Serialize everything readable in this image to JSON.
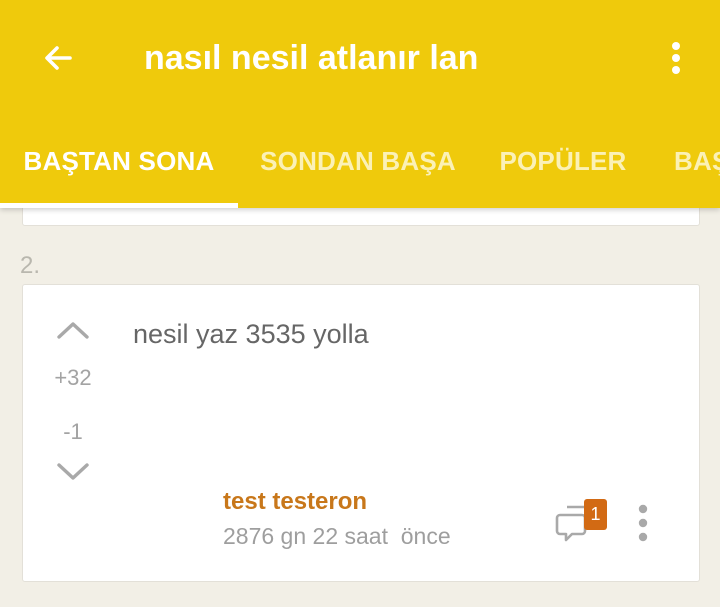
{
  "app_bar": {
    "title": "nasıl nesil atlanır lan",
    "back_icon": "arrow-left-icon",
    "menu_icon": "more-vertical-icon",
    "background_color": "#efca0c"
  },
  "tabs": [
    {
      "label": "BAŞTAN SONA",
      "active": true
    },
    {
      "label": "SONDAN BAŞA",
      "active": false
    },
    {
      "label": "POPÜLER",
      "active": false
    },
    {
      "label": "BAŞ",
      "active": false
    }
  ],
  "entry": {
    "number": "2.",
    "upvotes": "+32",
    "downvotes": "-1",
    "text": "nesil yaz 3535 yolla",
    "author": "test testeron",
    "timestamp": "2876 gn 22 saat  önce",
    "comment_count": "1",
    "accent_color": "#c8771a",
    "badge_color": "#d26a14"
  }
}
